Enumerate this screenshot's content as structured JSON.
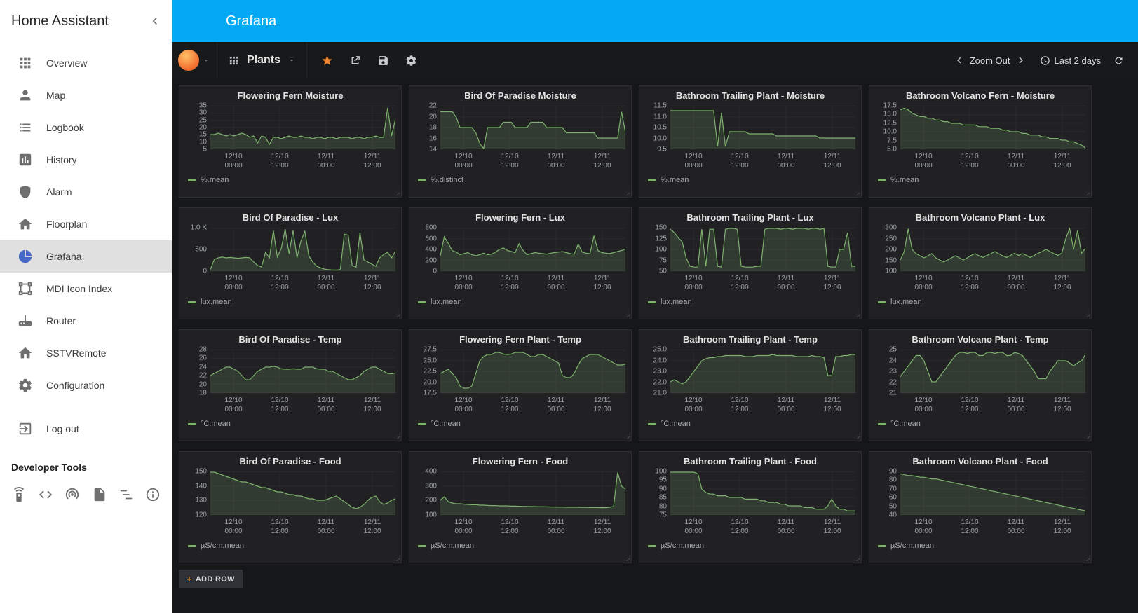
{
  "colors": {
    "header_blue": "#03a9f4",
    "series_line": "#7eb26d",
    "series_fill": "rgba(126,178,109,0.18)",
    "star_orange": "#eb842c",
    "panel_background": "#212124",
    "page_background": "#161719"
  },
  "sidebar": {
    "title": "Home Assistant",
    "collapse_icon": "chevron-left",
    "items": [
      {
        "label": "Overview",
        "icon": "apps-grid"
      },
      {
        "label": "Map",
        "icon": "account"
      },
      {
        "label": "Logbook",
        "icon": "format-list-bulleted"
      },
      {
        "label": "History",
        "icon": "poll-box"
      },
      {
        "label": "Alarm",
        "icon": "shield"
      },
      {
        "label": "Floorplan",
        "icon": "home"
      },
      {
        "label": "Grafana",
        "icon": "chart-pie",
        "active": true
      },
      {
        "label": "MDI Icon Index",
        "icon": "vector-square"
      },
      {
        "label": "Router",
        "icon": "router"
      },
      {
        "label": "SSTVRemote",
        "icon": "home"
      },
      {
        "label": "Configuration",
        "icon": "gear"
      },
      {
        "label": "Log out",
        "icon": "exit-to-app"
      }
    ],
    "developer_tools": {
      "label": "Developer Tools",
      "tools": [
        "services-remote",
        "states-code-tags",
        "events-radio-tower",
        "templates-file",
        "mqtt-list",
        "info"
      ]
    }
  },
  "header": {
    "title": "Grafana"
  },
  "grafana_nav": {
    "logo": "grafana-flame",
    "dashboard_icon": "grid-9",
    "dashboard_name": "Plants",
    "icons": [
      "star",
      "share",
      "save",
      "settings"
    ],
    "zoom_out_label": "Zoom Out",
    "time_range_icon": "clock",
    "time_range": "Last 2 days",
    "refresh_icon": "refresh"
  },
  "dashboard": {
    "add_row": {
      "plus": "+",
      "label": "ADD ROW"
    },
    "x_tick_fractions": [
      0.125,
      0.375,
      0.625,
      0.875
    ],
    "x_ticks": [
      {
        "date": "12/10",
        "time": "00:00"
      },
      {
        "date": "12/10",
        "time": "12:00"
      },
      {
        "date": "12/11",
        "time": "00:00"
      },
      {
        "date": "12/11",
        "time": "12:00"
      }
    ],
    "panels": [
      {
        "title": "Flowering Fern Moisture",
        "legend": "%.mean",
        "y_ticks": [
          "35",
          "30",
          "25",
          "20",
          "15",
          "10",
          "5"
        ],
        "y_min": 5,
        "y_max": 35,
        "values": [
          15,
          15,
          16,
          15,
          14,
          15,
          14,
          15,
          16,
          15,
          13,
          14,
          9,
          14,
          13,
          8,
          13,
          13,
          12,
          13,
          14,
          13,
          13,
          14,
          13,
          13,
          12,
          13,
          13,
          12,
          13,
          13,
          12,
          13,
          13,
          13,
          12,
          13,
          13,
          12,
          13,
          13,
          14,
          13,
          13,
          34,
          14,
          26
        ]
      },
      {
        "title": "Bird Of Paradise Moisture",
        "legend": "%.distinct",
        "y_ticks": [
          "22",
          "20",
          "18",
          "16",
          "14"
        ],
        "y_min": 14,
        "y_max": 22,
        "values": [
          21,
          21,
          21,
          21,
          20,
          18,
          18,
          18,
          18,
          17,
          15,
          14,
          18,
          18,
          18,
          18,
          19,
          19,
          19,
          18,
          18,
          18,
          18,
          19,
          19,
          19,
          19,
          18,
          18,
          18,
          18,
          18,
          17,
          17,
          17,
          17,
          17,
          17,
          17,
          17,
          16,
          16,
          16,
          16,
          16,
          16,
          21,
          17
        ]
      },
      {
        "title": "Bathroom Trailing Plant - Moisture",
        "legend": "%.mean",
        "y_ticks": [
          "11.5",
          "11.0",
          "10.5",
          "10.0",
          "9.5"
        ],
        "y_min": 9.5,
        "y_max": 11.5,
        "values": [
          11.3,
          11.3,
          11.3,
          11.3,
          11.3,
          11.3,
          11.3,
          11.3,
          11.3,
          11.3,
          11.3,
          11.3,
          9.6,
          11.2,
          9.6,
          10.3,
          10.3,
          10.3,
          10.3,
          10.3,
          10.2,
          10.2,
          10.2,
          10.2,
          10.2,
          10.2,
          10.2,
          10.1,
          10.1,
          10.1,
          10.1,
          10.1,
          10.1,
          10.1,
          10.1,
          10.1,
          10.1,
          10.1,
          10,
          10,
          10,
          10,
          10,
          10,
          10,
          10,
          10,
          10
        ]
      },
      {
        "title": "Bathroom Volcano Fern - Moisture",
        "legend": "%.mean",
        "y_ticks": [
          "17.5",
          "15.0",
          "12.5",
          "10.0",
          "7.5",
          "5.0"
        ],
        "y_min": 5,
        "y_max": 17.5,
        "values": [
          16.5,
          17,
          16.5,
          15.5,
          15,
          14.5,
          14.5,
          14,
          14,
          13.5,
          13.5,
          13,
          13,
          12.5,
          12.5,
          12.5,
          12,
          12,
          12,
          12,
          11.5,
          11.5,
          11.5,
          11,
          11,
          11,
          10.5,
          10.5,
          10,
          10,
          10,
          9.5,
          9.5,
          9,
          9,
          9,
          8.5,
          8.5,
          8,
          8,
          8,
          7.5,
          7.5,
          7,
          7,
          6.5,
          6,
          5.2
        ]
      },
      {
        "title": "Bird Of Paradise - Lux",
        "legend": "lux.mean",
        "y_ticks": [
          "1.0 K",
          "500",
          "0"
        ],
        "y_min": 0,
        "y_max": 1000,
        "values": [
          20,
          260,
          300,
          320,
          300,
          310,
          300,
          290,
          300,
          310,
          300,
          200,
          120,
          80,
          430,
          300,
          950,
          320,
          520,
          980,
          400,
          950,
          300,
          700,
          930,
          350,
          200,
          100,
          60,
          30,
          20,
          10,
          10,
          20,
          860,
          840,
          120,
          80,
          900,
          250,
          200,
          150,
          100,
          300,
          380,
          430,
          300,
          460
        ]
      },
      {
        "title": "Flowering Fern - Lux",
        "legend": "lux.mean",
        "y_ticks": [
          "800",
          "600",
          "400",
          "200",
          "0"
        ],
        "y_min": 0,
        "y_max": 800,
        "values": [
          280,
          640,
          520,
          380,
          350,
          300,
          320,
          340,
          300,
          280,
          300,
          330,
          300,
          310,
          350,
          400,
          430,
          380,
          360,
          340,
          510,
          380,
          300,
          320,
          340,
          330,
          320,
          310,
          330,
          340,
          350,
          360,
          340,
          320,
          310,
          500,
          350,
          330,
          320,
          660,
          380,
          340,
          330,
          320,
          340,
          360,
          380,
          410
        ]
      },
      {
        "title": "Bathroom Trailing Plant - Lux",
        "legend": "lux.mean",
        "y_ticks": [
          "150",
          "125",
          "100",
          "75",
          "50"
        ],
        "y_min": 50,
        "y_max": 150,
        "values": [
          148,
          140,
          128,
          118,
          80,
          60,
          58,
          58,
          148,
          60,
          148,
          148,
          60,
          58,
          148,
          150,
          150,
          148,
          60,
          58,
          58,
          58,
          60,
          60,
          148,
          150,
          150,
          150,
          148,
          150,
          150,
          148,
          150,
          150,
          150,
          148,
          150,
          150,
          148,
          150,
          60,
          58,
          58,
          100,
          100,
          140,
          60,
          60
        ]
      },
      {
        "title": "Bathroom Volcano Plant - Lux",
        "legend": "lux.mean",
        "y_ticks": [
          "300",
          "250",
          "200",
          "150",
          "100"
        ],
        "y_min": 100,
        "y_max": 300,
        "values": [
          150,
          190,
          298,
          200,
          180,
          170,
          160,
          170,
          180,
          160,
          150,
          140,
          150,
          160,
          170,
          160,
          150,
          160,
          172,
          180,
          170,
          162,
          172,
          180,
          190,
          180,
          170,
          162,
          172,
          182,
          172,
          180,
          172,
          162,
          172,
          182,
          190,
          200,
          190,
          180,
          172,
          182,
          250,
          300,
          200,
          290,
          182,
          205
        ]
      },
      {
        "title": "Bird Of Paradise - Temp",
        "legend": "°C.mean",
        "y_ticks": [
          "28",
          "26",
          "24",
          "22",
          "20",
          "18"
        ],
        "y_min": 18,
        "y_max": 28,
        "values": [
          22,
          22.5,
          23,
          23.5,
          24,
          24,
          23.5,
          23,
          22,
          21,
          21,
          22,
          23,
          23.5,
          24,
          24,
          24.2,
          24,
          23.6,
          23.5,
          23.5,
          23.6,
          23.5,
          23.5,
          24,
          24,
          24,
          23.6,
          23.5,
          23.5,
          23,
          23,
          22.5,
          22,
          21.5,
          21,
          21,
          21.5,
          22,
          23,
          23.5,
          24,
          24,
          23.5,
          23,
          22.5,
          22.4,
          22.6
        ]
      },
      {
        "title": "Flowering Fern Plant - Temp",
        "legend": "°C.mean",
        "y_ticks": [
          "27.5",
          "25.0",
          "22.5",
          "20.0",
          "17.5"
        ],
        "y_min": 17.5,
        "y_max": 27.5,
        "values": [
          22,
          22.5,
          23,
          22,
          21,
          19,
          18.5,
          18.5,
          19,
          22,
          25,
          26,
          26.5,
          26.5,
          27,
          27,
          26.6,
          26.5,
          26.6,
          27,
          27,
          27,
          26.5,
          26,
          26,
          26.5,
          26.5,
          26,
          25.5,
          25,
          24.5,
          21.5,
          21,
          21,
          22,
          24,
          25.5,
          26,
          26.5,
          26.5,
          26.5,
          26,
          25.5,
          25,
          24.5,
          24,
          24,
          24.2
        ]
      },
      {
        "title": "Bathroom Trailing Plant - Temp",
        "legend": "°C.mean",
        "y_ticks": [
          "25.0",
          "24.0",
          "23.0",
          "22.0",
          "21.0"
        ],
        "y_min": 21,
        "y_max": 25,
        "values": [
          22,
          22.2,
          22,
          21.8,
          22,
          22.5,
          23,
          23.5,
          24,
          24.2,
          24.3,
          24.3,
          24.4,
          24.4,
          24.5,
          24.5,
          24.5,
          24.5,
          24.5,
          24.4,
          24.4,
          24.4,
          24.5,
          24.5,
          24.5,
          24.5,
          24.6,
          24.5,
          24.5,
          24.5,
          24.5,
          24.5,
          24.4,
          24.4,
          24.4,
          24.4,
          24.5,
          24.4,
          24.4,
          24.3,
          22.6,
          22.6,
          24.4,
          24.4,
          24.5,
          24.5,
          24.6,
          24.6
        ]
      },
      {
        "title": "Bathroom Volcano Plant - Temp",
        "legend": "°C.mean",
        "y_ticks": [
          "25",
          "24",
          "23",
          "22",
          "21"
        ],
        "y_min": 21,
        "y_max": 25,
        "values": [
          22.5,
          23,
          23.5,
          24,
          24.5,
          24.5,
          24,
          23,
          22,
          22,
          22.5,
          23,
          23.5,
          24,
          24.5,
          24.8,
          24.8,
          24.7,
          24.8,
          24.8,
          24.5,
          24.5,
          24.8,
          24.8,
          24.7,
          24.8,
          24.8,
          24.5,
          24.5,
          24.8,
          24.7,
          24.5,
          24,
          23.5,
          23,
          22.3,
          22.3,
          22.3,
          23,
          23.5,
          24,
          24,
          24,
          23.8,
          23.5,
          23.8,
          24,
          24.6
        ]
      },
      {
        "title": "Bird Of Paradise - Food",
        "legend": "µS/cm.mean",
        "y_ticks": [
          "150",
          "140",
          "130",
          "120"
        ],
        "y_min": 120,
        "y_max": 150,
        "values": [
          150,
          150,
          149,
          148,
          147,
          146,
          145,
          144,
          143,
          143,
          142,
          141,
          140,
          139,
          139,
          138,
          137,
          136,
          136,
          135,
          134,
          134,
          133,
          133,
          132,
          131,
          131,
          130,
          130,
          130,
          131,
          132,
          133,
          131,
          129,
          127,
          125,
          124,
          125,
          127,
          130,
          132,
          133,
          129,
          127,
          128,
          130,
          131
        ]
      },
      {
        "title": "Flowering Fern - Food",
        "legend": "µS/cm.mean",
        "y_ticks": [
          "400",
          "300",
          "200",
          "100"
        ],
        "y_min": 100,
        "y_max": 400,
        "values": [
          200,
          225,
          190,
          180,
          175,
          175,
          172,
          170,
          168,
          168,
          165,
          165,
          163,
          162,
          162,
          160,
          160,
          160,
          158,
          158,
          157,
          156,
          156,
          155,
          155,
          154,
          154,
          153,
          152,
          152,
          151,
          151,
          150,
          150,
          150,
          150,
          149,
          149,
          148,
          148,
          148,
          147,
          147,
          150,
          155,
          398,
          300,
          280
        ]
      },
      {
        "title": "Bathroom Trailing Plant - Food",
        "legend": "µS/cm.mean",
        "y_ticks": [
          "100",
          "95",
          "90",
          "85",
          "80",
          "75"
        ],
        "y_min": 75,
        "y_max": 100,
        "values": [
          100,
          100,
          100,
          100,
          100,
          100,
          100,
          99,
          90,
          88,
          87,
          87,
          86,
          86,
          86,
          85,
          85,
          85,
          85,
          84,
          84,
          84,
          84,
          83,
          83,
          82,
          82,
          82,
          81,
          81,
          80,
          80,
          80,
          80,
          79,
          79,
          79,
          78,
          78,
          78,
          80,
          84,
          80,
          78,
          78,
          77,
          77,
          77
        ]
      },
      {
        "title": "Bathroom Volcano Plant - Food",
        "legend": "µS/cm.mean",
        "y_ticks": [
          "90",
          "80",
          "70",
          "60",
          "50",
          "40"
        ],
        "y_min": 40,
        "y_max": 90,
        "values": [
          88,
          87,
          86,
          86,
          85,
          84,
          84,
          83,
          82,
          82,
          81,
          80,
          79,
          78,
          77,
          76,
          75,
          74,
          73,
          72,
          71,
          70,
          69,
          68,
          67,
          66,
          65,
          64,
          63,
          62,
          61,
          60,
          59,
          58,
          57,
          56,
          55,
          54,
          53,
          52,
          51,
          50,
          49,
          48,
          47,
          46,
          45,
          44
        ]
      }
    ]
  }
}
